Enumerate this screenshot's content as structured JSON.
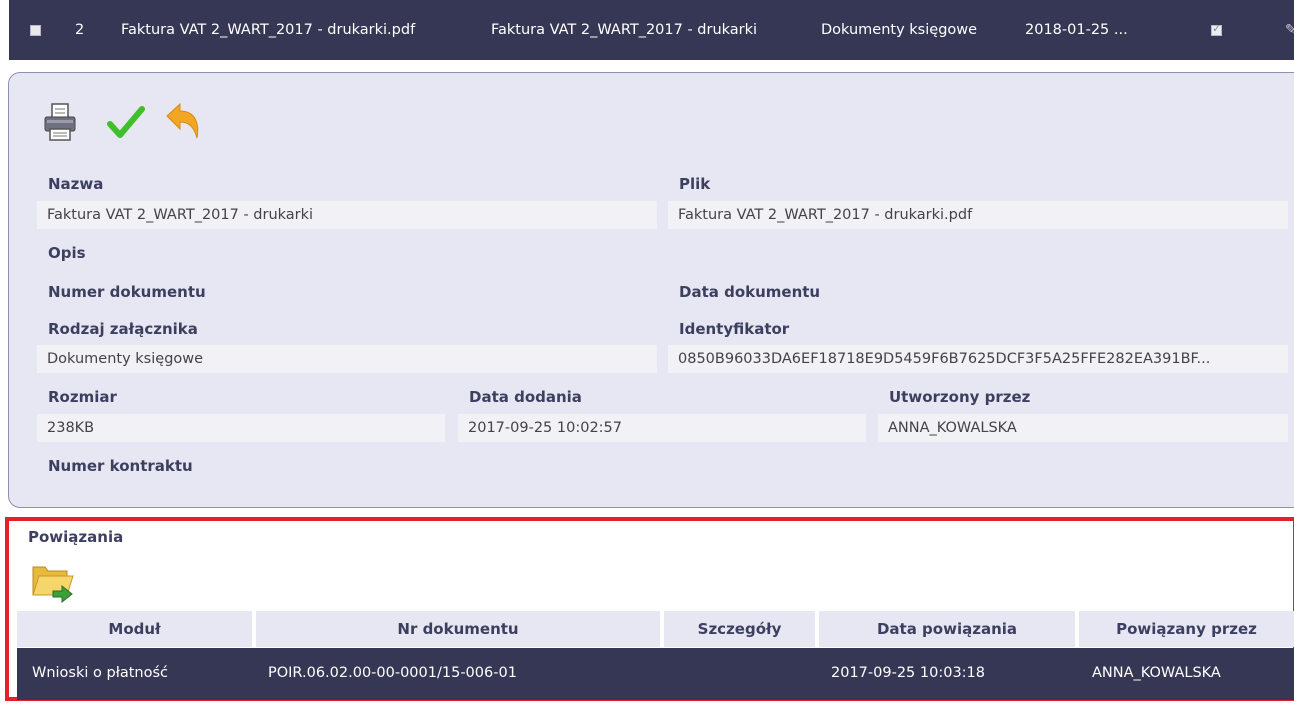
{
  "top_row": {
    "number": "2",
    "file_name": "Faktura VAT 2_WART_2017 - drukarki.pdf",
    "name": "Faktura VAT 2_WART_2017 - drukarki",
    "type": "Dokumenty księgowe",
    "date": "2018-01-25 ..."
  },
  "details": {
    "labels": {
      "nazwa": "Nazwa",
      "plik": "Plik",
      "opis": "Opis",
      "numer_dokumentu": "Numer dokumentu",
      "data_dokumentu": "Data dokumentu",
      "rodzaj_zalacznika": "Rodzaj załącznika",
      "identyfikator": "Identyfikator",
      "rozmiar": "Rozmiar",
      "data_dodania": "Data dodania",
      "utworzony_przez": "Utworzony przez",
      "numer_kontraktu": "Numer kontraktu"
    },
    "values": {
      "nazwa": "Faktura VAT 2_WART_2017 - drukarki",
      "plik": "Faktura VAT 2_WART_2017 - drukarki.pdf",
      "rodzaj_zalacznika": "Dokumenty księgowe",
      "identyfikator": "0850B96033DA6EF18718E9D5459F6B7625DCF3F5A25FFE282EA391BF...",
      "rozmiar": "238KB",
      "data_dodania": "2017-09-25 10:02:57",
      "utworzony_przez": "ANNA_KOWALSKA"
    }
  },
  "relations": {
    "title": "Powiązania",
    "columns": [
      "Moduł",
      "Nr dokumentu",
      "Szczegóły",
      "Data powiązania",
      "Powiązany przez"
    ],
    "rows": [
      {
        "modul": "Wnioski o płatność",
        "nr_dokumentu": "POIR.06.02.00-00-0001/15-006-01",
        "szczegoly": "",
        "data_powiazania": "2017-09-25 10:03:18",
        "powiazany_przez": "ANNA_KOWALSKA"
      }
    ]
  },
  "colors": {
    "dark_row": "#353754",
    "panel_bg": "#e7e7f3",
    "highlight_border": "#e5202a",
    "label_text": "#3d3f60"
  }
}
